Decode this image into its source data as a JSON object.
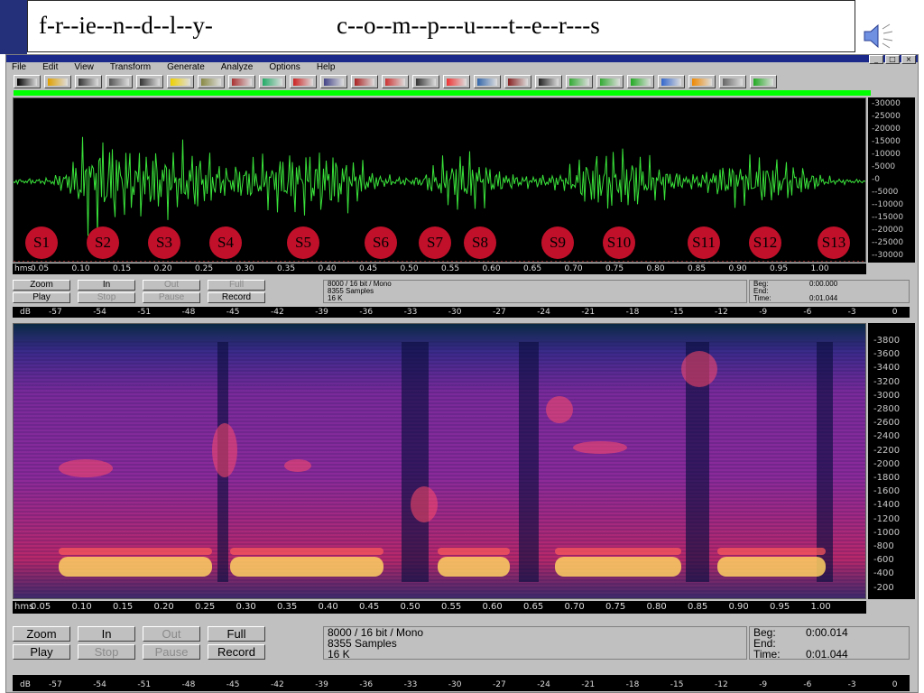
{
  "slide_title": {
    "part1": "f-r--ie--n--d--l--y-",
    "part2": "c--o--m--p---u----t--e--r---s"
  },
  "menu": [
    "File",
    "Edit",
    "View",
    "Transform",
    "Generate",
    "Analyze",
    "Options",
    "Help"
  ],
  "waveform": {
    "amplitude_ticks": [
      "30000",
      "25000",
      "20000",
      "15000",
      "10000",
      "5000",
      "0",
      "-5000",
      "-10000",
      "-15000",
      "-20000",
      "-25000",
      "-30000"
    ],
    "segment_markers": [
      "S1",
      "S2",
      "S3",
      "S4",
      "S5",
      "S6",
      "S7",
      "S8",
      "S9",
      "S10",
      "S11",
      "S12",
      "S13"
    ],
    "time_axis_label": "hms",
    "time_ticks": [
      "0.05",
      "0.10",
      "0.15",
      "0.20",
      "0.25",
      "0.30",
      "0.35",
      "0.40",
      "0.45",
      "0.50",
      "0.55",
      "0.60",
      "0.65",
      "0.70",
      "0.75",
      "0.80",
      "0.85",
      "0.90",
      "0.95",
      "1.00"
    ],
    "colors": {
      "trace": "#39e23a",
      "background": "#000000",
      "marker": "#c0102a"
    }
  },
  "controls_top": {
    "buttons": [
      "Zoom",
      "In",
      "Out",
      "Full",
      "Play",
      "Stop",
      "Pause",
      "Record"
    ],
    "disabled": [
      "Out",
      "Full",
      "Stop",
      "Pause"
    ],
    "format": "8000 / 16 bit / Mono",
    "samples": "8355 Samples",
    "size": "16 K",
    "beg_label": "Beg:",
    "beg_value": "0:00.000",
    "end_label": "End:",
    "end_value": "",
    "time_label": "Time:",
    "time_value": "0:01.044"
  },
  "db_scale": {
    "label": "dB",
    "ticks": [
      "-57",
      "-54",
      "-51",
      "-48",
      "-45",
      "-42",
      "-39",
      "-36",
      "-33",
      "-30",
      "-27",
      "-24",
      "-21",
      "-18",
      "-15",
      "-12",
      "-9",
      "-6",
      "-3",
      "0"
    ]
  },
  "spectrogram": {
    "frequency_ticks": [
      "3800",
      "3600",
      "3400",
      "3200",
      "3000",
      "2800",
      "2600",
      "2400",
      "2200",
      "2000",
      "1800",
      "1600",
      "1400",
      "1200",
      "1000",
      "800",
      "600",
      "400",
      "200"
    ],
    "time_axis_label": "hms",
    "time_ticks": [
      "0.05",
      "0.10",
      "0.15",
      "0.20",
      "0.25",
      "0.30",
      "0.35",
      "0.40",
      "0.45",
      "0.50",
      "0.55",
      "0.60",
      "0.65",
      "0.70",
      "0.75",
      "0.80",
      "0.85",
      "0.90",
      "0.95",
      "1.00"
    ]
  },
  "controls_bottom": {
    "buttons": [
      "Zoom",
      "In",
      "Out",
      "Full",
      "Play",
      "Stop",
      "Pause",
      "Record"
    ],
    "disabled": [
      "Out",
      "Stop",
      "Pause"
    ],
    "format": "8000 / 16 bit / Mono",
    "samples": "8355 Samples",
    "size": "16 K",
    "beg_label": "Beg:",
    "beg_value": "0:00.014",
    "end_label": "End:",
    "end_value": "",
    "time_label": "Time:",
    "time_value": "0:01.044"
  }
}
